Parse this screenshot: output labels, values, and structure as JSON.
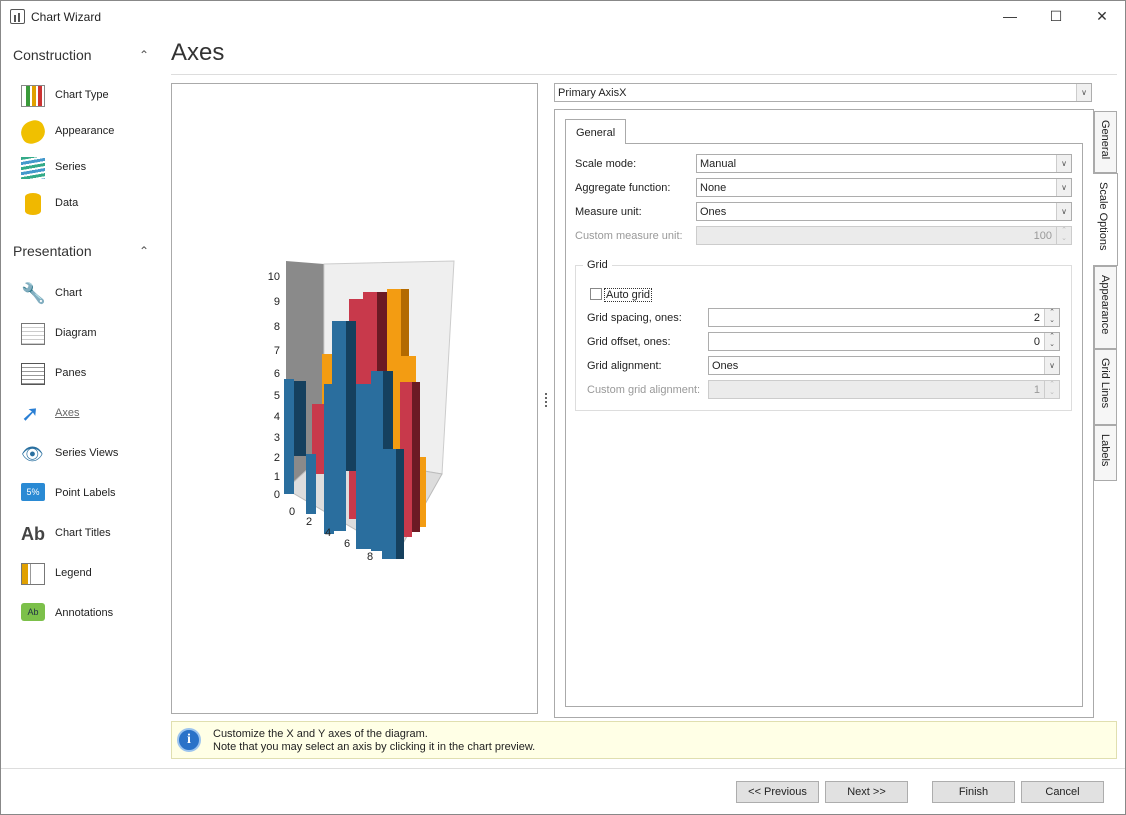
{
  "window": {
    "title": "Chart Wizard"
  },
  "sidebar": {
    "construction": {
      "title": "Construction",
      "items": [
        {
          "label": "Chart Type"
        },
        {
          "label": "Appearance"
        },
        {
          "label": "Series"
        },
        {
          "label": "Data"
        }
      ]
    },
    "presentation": {
      "title": "Presentation",
      "items": [
        {
          "label": "Chart"
        },
        {
          "label": "Diagram"
        },
        {
          "label": "Panes"
        },
        {
          "label": "Axes"
        },
        {
          "label": "Series Views"
        },
        {
          "label": "Point Labels"
        },
        {
          "label": "Chart Titles"
        },
        {
          "label": "Legend"
        },
        {
          "label": "Annotations"
        }
      ]
    },
    "selected": "Axes"
  },
  "page": {
    "title": "Axes"
  },
  "preview": {
    "y_ticks": [
      "0",
      "1",
      "2",
      "3",
      "4",
      "5",
      "6",
      "7",
      "8",
      "9",
      "10"
    ],
    "x_ticks": [
      "0",
      "2",
      "4",
      "6",
      "8"
    ],
    "colors": {
      "blue": "#2a6e9e",
      "red": "#c8394b",
      "orange": "#f39c12"
    }
  },
  "axis_selector": {
    "value": "Primary AxisX"
  },
  "side_tabs": [
    {
      "label": "General"
    },
    {
      "label": "Scale Options"
    },
    {
      "label": "Appearance"
    },
    {
      "label": "Grid Lines"
    },
    {
      "label": "Labels"
    }
  ],
  "selected_side_tab": "Scale Options",
  "inner_tab": {
    "label": "General"
  },
  "form": {
    "scale_mode": {
      "label": "Scale mode:",
      "value": "Manual"
    },
    "aggregate_function": {
      "label": "Aggregate function:",
      "value": "None"
    },
    "measure_unit": {
      "label": "Measure unit:",
      "value": "Ones"
    },
    "custom_measure_unit": {
      "label": "Custom measure unit:",
      "value": "100"
    },
    "grid": {
      "title": "Grid",
      "auto_grid": {
        "label": "Auto grid",
        "checked": false
      },
      "spacing": {
        "label": "Grid spacing, ones:",
        "value": "2"
      },
      "offset": {
        "label": "Grid offset, ones:",
        "value": "0"
      },
      "alignment": {
        "label": "Grid alignment:",
        "value": "Ones"
      },
      "custom_alignment": {
        "label": "Custom grid alignment:",
        "value": "1"
      }
    }
  },
  "info": {
    "line1": "Customize the X and Y axes of the diagram.",
    "line2": "Note that you may select an axis by clicking it in the chart preview."
  },
  "buttons": {
    "previous": "<< Previous",
    "next": "Next >>",
    "finish": "Finish",
    "cancel": "Cancel"
  }
}
